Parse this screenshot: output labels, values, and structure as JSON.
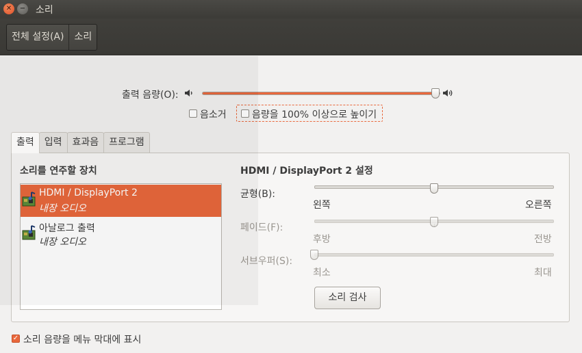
{
  "window": {
    "title": "소리"
  },
  "toolbar": {
    "all_settings": "전체 설정(A)",
    "sound": "소리"
  },
  "output_volume": {
    "label": "출력 음량(O):",
    "level_percent": 98
  },
  "mute": {
    "label": "음소거",
    "checked": false
  },
  "overamplify": {
    "label": "음량을 100% 이상으로 높이기",
    "checked": false
  },
  "tabs": [
    "출력",
    "입력",
    "효과음",
    "프로그램"
  ],
  "devices": {
    "heading": "소리를 연주할 장치",
    "items": [
      {
        "name": "HDMI / DisplayPort 2",
        "sub": "내장 오디오",
        "selected": true
      },
      {
        "name": "아날로그 출력",
        "sub": "내장 오디오",
        "selected": false
      }
    ]
  },
  "settings": {
    "heading": "HDMI / DisplayPort 2 설정",
    "balance": {
      "label": "균형(B):",
      "left": "왼쪽",
      "right": "오른쪽",
      "position": 0.5,
      "enabled": true
    },
    "fade": {
      "label": "페이드(F):",
      "left": "후방",
      "right": "전방",
      "position": 0.5,
      "enabled": false
    },
    "subwoofer": {
      "label": "서브우퍼(S):",
      "left": "최소",
      "right": "최대",
      "position": 0.0,
      "enabled": false
    },
    "test_button": "소리 검사"
  },
  "show_in_menu": {
    "label": "소리 음량을 메뉴 막대에 표시",
    "checked": true
  },
  "colors": {
    "accent": "#e9683c",
    "titlebar": "#3c3b37"
  }
}
